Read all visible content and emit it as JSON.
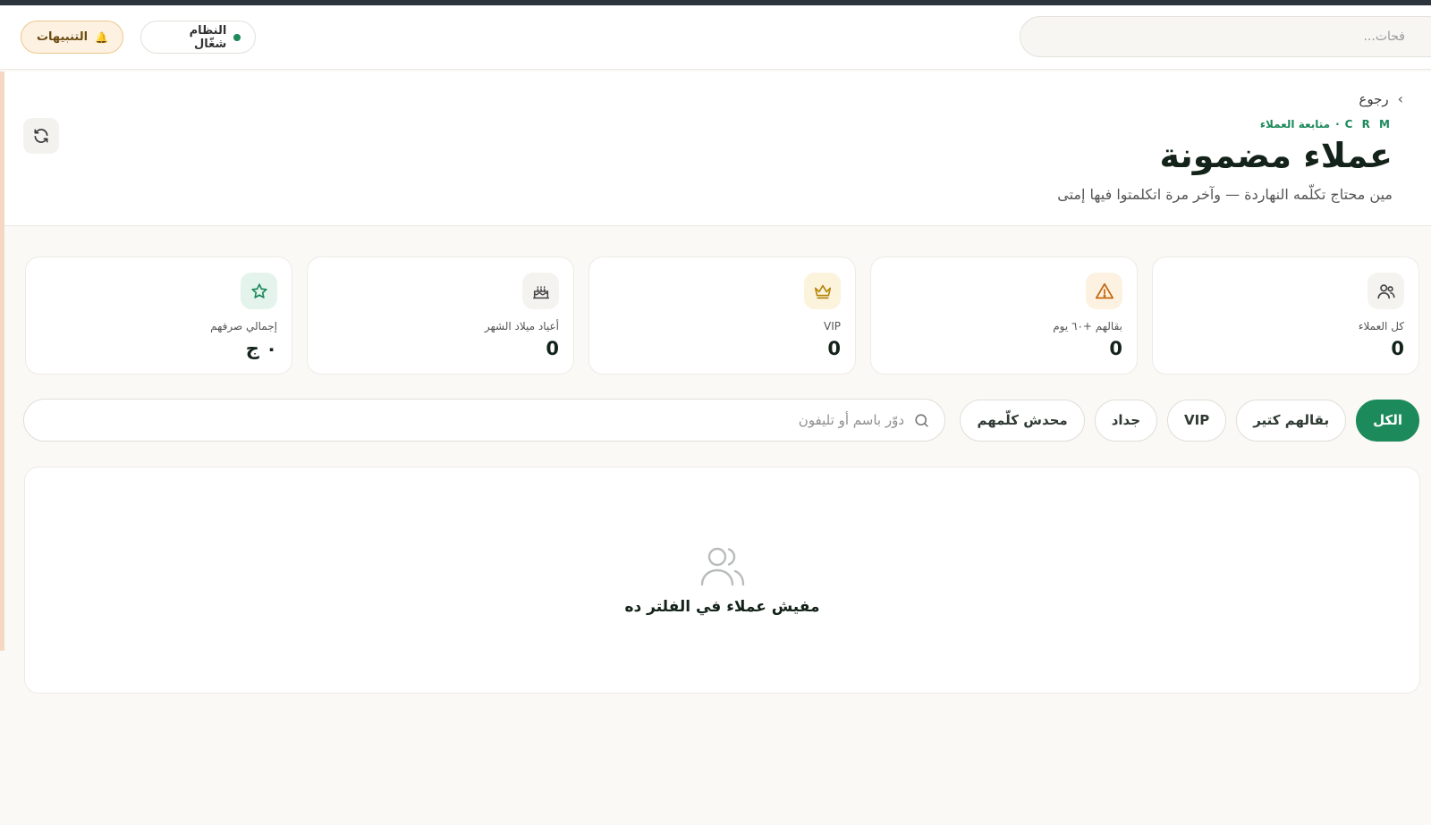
{
  "topbar": {
    "search_placeholder": "فحات...",
    "status_label": "النظام شغّال",
    "alerts_label": "التنبيهات"
  },
  "header": {
    "back_label": "رجوع",
    "breadcrumb": [
      "C R M",
      "·",
      "متابعة العملاء"
    ],
    "title": "عملاء مضمونة",
    "subtitle": "مين محتاج تكلّمه النهاردة — وآخر مرة اتكلمتوا فيها إمتى"
  },
  "stats": [
    {
      "label": "كل العملاء",
      "value": "0",
      "icon": "users-icon"
    },
    {
      "label": "بقالهم +٦٠ يوم",
      "value": "0",
      "icon": "warning-icon"
    },
    {
      "label": "VIP",
      "value": "0",
      "icon": "crown-icon"
    },
    {
      "label": "أعياد ميلاد الشهر",
      "value": "0",
      "icon": "cake-icon"
    },
    {
      "label": "إجمالي صرفهم",
      "value": "٠ ج",
      "icon": "star-icon"
    }
  ],
  "filters": {
    "chips": [
      "الكل",
      "بقالهم كتير",
      "VIP",
      "جداد",
      "محدش كلّمهم"
    ],
    "active_index": 0,
    "search_placeholder": "دوّر باسم أو تليفون"
  },
  "empty_state": {
    "message": "مفيش عملاء في الفلتر ده"
  },
  "colors": {
    "accent": "#1c8a5b",
    "alert_bg": "#fdf2e1",
    "warning": "#c2690f",
    "crown": "#b7860b"
  }
}
